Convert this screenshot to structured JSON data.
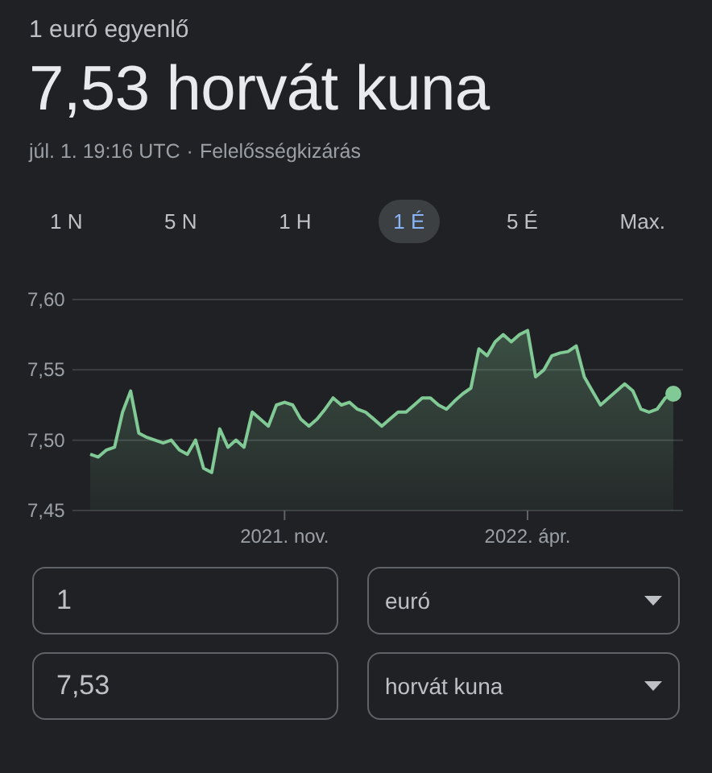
{
  "header": {
    "caption": "1 euró egyenlő",
    "result": "7,53 horvát kuna",
    "timestamp": "júl. 1. 19:16 UTC",
    "separator": "·",
    "disclaimer_link": "Felelősségkizárás"
  },
  "ranges": [
    {
      "label": "1 N",
      "selected": false
    },
    {
      "label": "5 N",
      "selected": false
    },
    {
      "label": "1 H",
      "selected": false
    },
    {
      "label": "1 É",
      "selected": true
    },
    {
      "label": "5 É",
      "selected": false
    },
    {
      "label": "Max.",
      "selected": false
    }
  ],
  "chart": {
    "chart_data": {
      "type": "area",
      "categories": [
        null,
        null,
        null,
        null,
        null,
        null,
        null,
        null,
        null,
        null,
        null,
        null,
        null,
        null,
        null,
        null,
        null,
        null,
        null,
        null,
        null,
        null,
        null,
        null,
        "2021. nov.",
        null,
        null,
        null,
        null,
        null,
        null,
        null,
        null,
        null,
        null,
        null,
        null,
        null,
        null,
        null,
        null,
        null,
        null,
        null,
        null,
        null,
        null,
        null,
        null,
        null,
        null,
        null,
        null,
        null,
        "2022. ápr.",
        null,
        null,
        null,
        null,
        null,
        null,
        null,
        null,
        null,
        null,
        null,
        null,
        null,
        null,
        null,
        null,
        null,
        null
      ],
      "series": [
        {
          "color": "#81c995",
          "values": [
            7.49,
            7.488,
            7.493,
            7.495,
            7.52,
            7.535,
            7.505,
            7.502,
            7.5,
            7.498,
            7.5,
            7.493,
            7.49,
            7.5,
            7.48,
            7.477,
            7.508,
            7.495,
            7.5,
            7.495,
            7.52,
            7.515,
            7.51,
            7.525,
            7.527,
            7.525,
            7.515,
            7.51,
            7.515,
            7.522,
            7.53,
            7.525,
            7.527,
            7.522,
            7.52,
            7.515,
            7.51,
            7.515,
            7.52,
            7.52,
            7.525,
            7.53,
            7.53,
            7.525,
            7.522,
            7.528,
            7.533,
            7.537,
            7.565,
            7.56,
            7.57,
            7.575,
            7.57,
            7.575,
            7.578,
            7.545,
            7.55,
            7.56,
            7.562,
            7.563,
            7.567,
            7.545,
            7.535,
            7.525,
            7.53,
            7.535,
            7.54,
            7.535,
            7.522,
            7.52,
            7.522,
            7.53,
            7.533
          ]
        }
      ],
      "ylim": [
        7.45,
        7.6
      ],
      "yticks": [
        {
          "value": 7.6,
          "label": "7,60"
        },
        {
          "value": 7.55,
          "label": "7,55"
        },
        {
          "value": 7.5,
          "label": "7,50"
        },
        {
          "value": 7.45,
          "label": "7,45"
        }
      ]
    }
  },
  "converter": {
    "rows": [
      {
        "amount": "1",
        "currency": "euró"
      },
      {
        "amount": "7,53",
        "currency": "horvát kuna"
      }
    ]
  }
}
